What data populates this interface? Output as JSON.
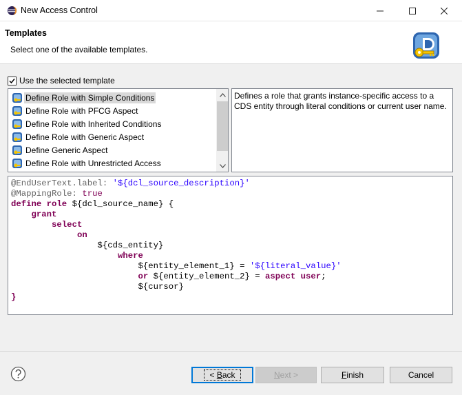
{
  "window": {
    "title": "New Access Control"
  },
  "header": {
    "title": "Templates",
    "message": "Select one of the available templates."
  },
  "use_template": {
    "label": "Use the selected template",
    "checked": true
  },
  "templates": [
    {
      "label": "Define Role with Simple Conditions",
      "selected": true
    },
    {
      "label": "Define Role with PFCG Aspect"
    },
    {
      "label": "Define Role with Inherited Conditions"
    },
    {
      "label": "Define Role with Generic Aspect"
    },
    {
      "label": "Define Generic Aspect"
    },
    {
      "label": "Define Role with Unrestricted Access"
    }
  ],
  "description": "Defines a role that grants instance-specific access to a CDS entity through literal conditions or current user name.",
  "code": {
    "l1a": "@EndUserText.label:",
    "l1b": "'${dcl_source_description}'",
    "l2a": "@MappingRole:",
    "l2b": "true",
    "l3a": "define role",
    "l3b": "${dcl_source_name} {",
    "l4": "grant",
    "l5": "select",
    "l6": "on",
    "l7": "${cds_entity}",
    "l8": "where",
    "l9a": "${entity_element_1} =",
    "l9b": "'${literal_value}'",
    "l10a": "or",
    "l10b": "${entity_element_2} =",
    "l10c": "aspect user",
    "l11": "${cursor}",
    "l12": "}"
  },
  "buttons": {
    "back": "Back",
    "back_mnemonic": "B",
    "next": "Next >",
    "next_mnemonic": "N",
    "finish": "Finish",
    "finish_mnemonic": "F",
    "cancel": "Cancel"
  },
  "icons": {
    "app": "eclipse-icon",
    "banner": "access-control-key-icon",
    "help": "help-icon",
    "template": "template-icon"
  }
}
